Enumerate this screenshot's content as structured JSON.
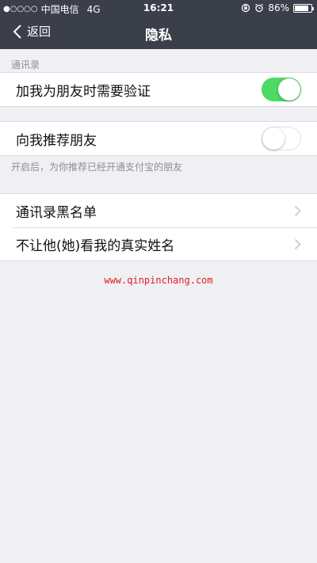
{
  "status_bar": {
    "signal_dots": "●○○○○",
    "carrier": "中国电信",
    "network": "4G",
    "time": "16:21",
    "battery_percent": "86%",
    "battery_level": 0.86
  },
  "nav": {
    "back_label": "返回",
    "title": "隐私"
  },
  "sections": {
    "contacts_header": "通讯录",
    "verify_label": "加我为朋友时需要验证",
    "verify_on": true,
    "recommend_label": "向我推荐朋友",
    "recommend_on": false,
    "recommend_footnote": "开启后，为你推荐已经开通支付宝的朋友",
    "blacklist_label": "通讯录黑名单",
    "hide_name_label": "不让他(她)看我的真实姓名"
  },
  "watermark": "www.qinpinchang.com",
  "colors": {
    "accent_green": "#4cd964",
    "nav_bg": "#3a3f4a",
    "page_bg": "#efeff4",
    "watermark_red": "#e0201f"
  }
}
